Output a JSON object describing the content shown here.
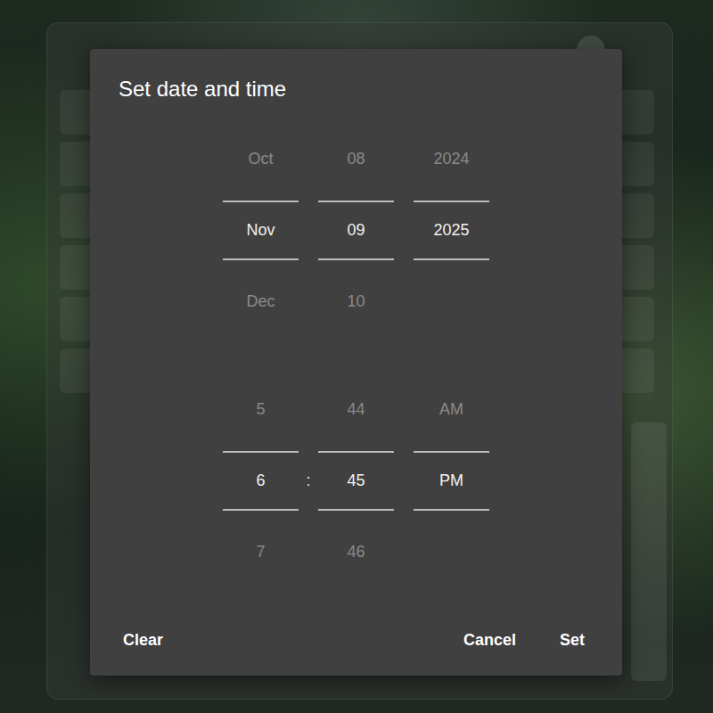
{
  "dialog": {
    "title": "Set date and time"
  },
  "date_columns": [
    {
      "name": "month",
      "items": [
        {
          "label": "Oct",
          "selected": false
        },
        {
          "label": "Nov",
          "selected": true
        },
        {
          "label": "Dec",
          "selected": false
        }
      ]
    },
    {
      "name": "day",
      "items": [
        {
          "label": "08",
          "selected": false
        },
        {
          "label": "09",
          "selected": true
        },
        {
          "label": "10",
          "selected": false
        }
      ]
    },
    {
      "name": "year",
      "items": [
        {
          "label": "2024",
          "selected": false
        },
        {
          "label": "2025",
          "selected": true
        }
      ]
    }
  ],
  "time_separator": ":",
  "time_columns": [
    {
      "name": "hour",
      "items": [
        {
          "label": "5",
          "selected": false
        },
        {
          "label": "6",
          "selected": true
        },
        {
          "label": "7",
          "selected": false
        }
      ]
    },
    {
      "name": "minute",
      "items": [
        {
          "label": "44",
          "selected": false
        },
        {
          "label": "45",
          "selected": true
        },
        {
          "label": "46",
          "selected": false
        }
      ]
    },
    {
      "name": "period",
      "items": [
        {
          "label": "AM",
          "selected": false
        },
        {
          "label": "PM",
          "selected": true
        }
      ]
    }
  ],
  "actions": {
    "start": [
      {
        "label": "Clear"
      }
    ],
    "end": [
      {
        "label": "Cancel"
      },
      {
        "label": "Set"
      }
    ]
  }
}
